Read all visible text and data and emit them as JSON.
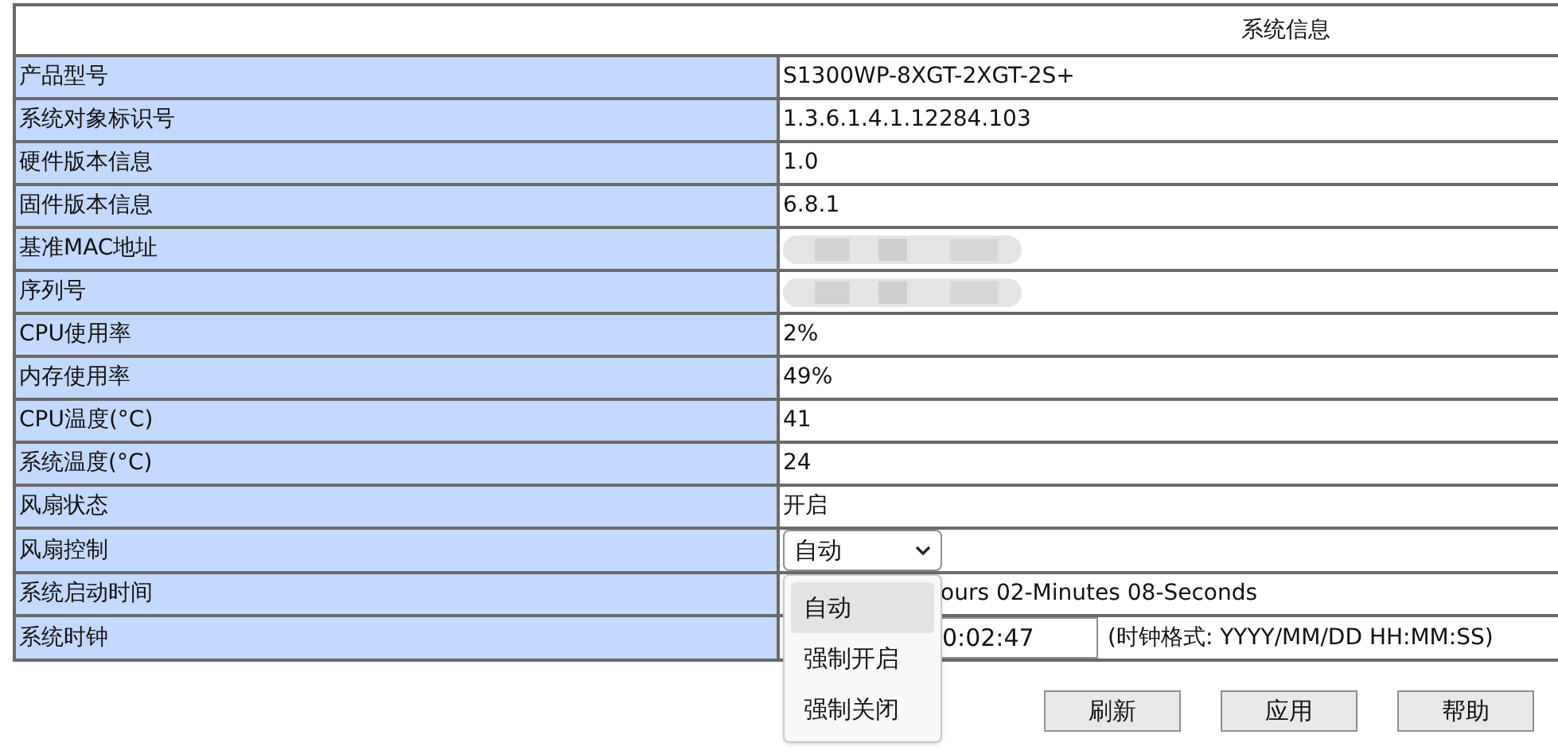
{
  "title": "系统信息",
  "rows": [
    {
      "label": "产品型号",
      "kind": "text",
      "value": "S1300WP-8XGT-2XGT-2S+"
    },
    {
      "label": "系统对象标识号",
      "kind": "text",
      "value": "1.3.6.1.4.1.12284.103"
    },
    {
      "label": "硬件版本信息",
      "kind": "text",
      "value": "1.0"
    },
    {
      "label": "固件版本信息",
      "kind": "text",
      "value": "6.8.1"
    },
    {
      "label": "基准MAC地址",
      "kind": "redacted"
    },
    {
      "label": "序列号",
      "kind": "redacted"
    },
    {
      "label": "CPU使用率",
      "kind": "text",
      "value": "2%"
    },
    {
      "label": "内存使用率",
      "kind": "text",
      "value": "49%"
    },
    {
      "label": "CPU温度(°C)",
      "kind": "text",
      "value": "41"
    },
    {
      "label": "系统温度(°C)",
      "kind": "text",
      "value": "24"
    },
    {
      "label": "风扇状态",
      "kind": "text",
      "value": "开启"
    },
    {
      "label": "风扇控制",
      "kind": "select",
      "value": "自动",
      "expanded": true,
      "options": [
        {
          "label": "自动",
          "selected": true
        },
        {
          "label": "强制开启",
          "selected": false
        },
        {
          "label": "强制关闭",
          "selected": false
        }
      ]
    },
    {
      "label": "系统启动时间",
      "kind": "covered_text",
      "value": "ours 02-Minutes 08-Seconds"
    },
    {
      "label": "系统时钟",
      "kind": "clock",
      "value": "0:02:47",
      "hint": "(时钟格式: YYYY/MM/DD HH:MM:SS)"
    }
  ],
  "buttons": [
    "刷新",
    "应用",
    "帮助"
  ]
}
